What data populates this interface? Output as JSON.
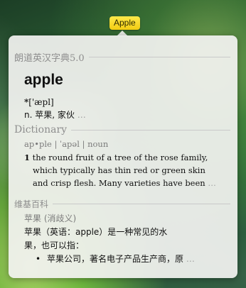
{
  "tooltip": {
    "word": "Apple"
  },
  "youdao": {
    "header": "朗道英汉字典5.0",
    "headword": "apple",
    "phonetic_prefix": "*",
    "phonetic": "['æpl]",
    "definition": "n. 苹果, 家伙",
    "ellipsis": "…"
  },
  "dictionary": {
    "header": "Dictionary",
    "pos_line": "ap•ple | ˈapəl | noun",
    "sense_number": "1",
    "definition_line1": "the round fruit of a tree of the rose family,",
    "definition_line2": "which typically has thin red or green skin",
    "definition_line3": "and crisp flesh. Many varieties have been",
    "ellipsis": "…"
  },
  "wikipedia": {
    "header": "维基百科",
    "subtitle": "苹果 (消歧义)",
    "body_line1": "苹果（英语：apple）是一种常见的水",
    "body_line2": "果，也可以指：",
    "bullet_marker": "•",
    "bullet_text": "苹果公司，著名电子产品生产商，原",
    "ellipsis": "…"
  }
}
